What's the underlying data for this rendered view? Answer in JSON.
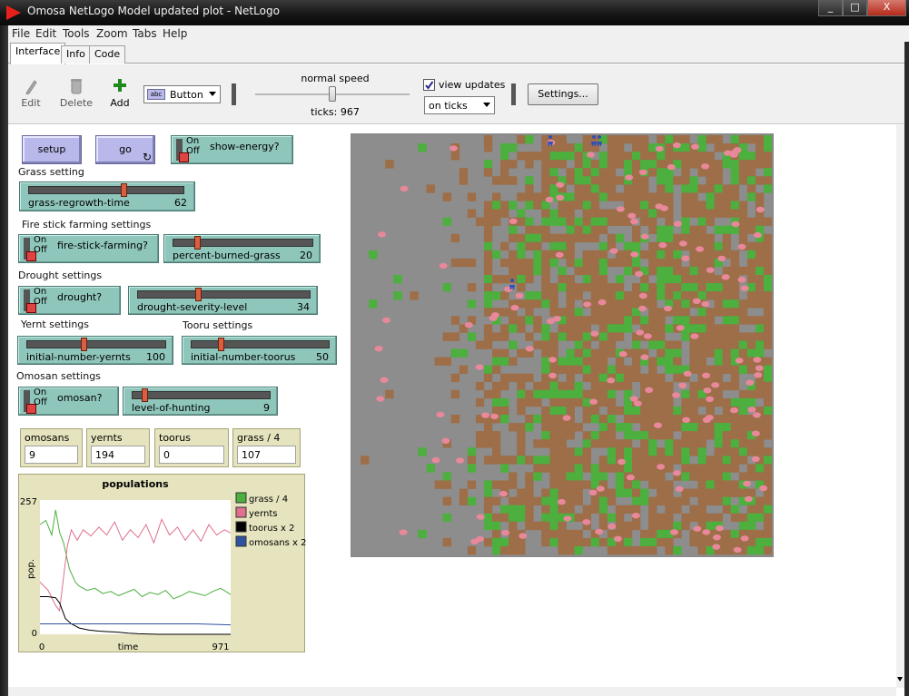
{
  "window": {
    "title": "Omosa NetLogo Model updated plot - NetLogo",
    "controls": [
      "_",
      "□",
      "X"
    ]
  },
  "menu": [
    "File",
    "Edit",
    "Tools",
    "Zoom",
    "Tabs",
    "Help"
  ],
  "tabs": [
    "Interface",
    "Info",
    "Code"
  ],
  "toolbar": {
    "edit": "Edit",
    "delete": "Delete",
    "add": "Add",
    "widget_type": "Button",
    "speed_label": "normal speed",
    "ticks": "ticks: 967",
    "view_updates": "view updates",
    "view_updates_checked": true,
    "update_mode": "on ticks",
    "settings": "Settings...",
    "speed_level": 0.5
  },
  "widgets": {
    "setup": "setup",
    "go": "go",
    "switch_on": "On",
    "switch_off": "Off",
    "show_energy": "show-energy?",
    "grass_note": "Grass setting",
    "grass_regrowth": {
      "name": "grass-regrowth-time",
      "value": "62",
      "fraction": 0.62
    },
    "fire_note": "Fire stick farming settings",
    "fire_switch": "fire-stick-farming?",
    "percent_burned": {
      "name": "percent-burned-grass",
      "value": "20",
      "fraction": 0.04
    },
    "drought_note": "Drought settings",
    "drought_switch": "drought?",
    "drought_severity": {
      "name": "drought-severity-level",
      "value": "34",
      "fraction": 0.34
    },
    "yernt_note": "Yernt settings",
    "tooru_note": "Tooru settings",
    "initial_yernts": {
      "name": "initial-number-yernts",
      "value": "100",
      "fraction": 0.4
    },
    "initial_toorus": {
      "name": "initial-number-toorus",
      "value": "50",
      "fraction": 0.2
    },
    "omosan_note": "Omosan settings",
    "omosan_switch": "omosan?",
    "hunting": {
      "name": "level-of-hunting",
      "value": "9",
      "fraction": 0.05
    }
  },
  "monitors": [
    {
      "label": "omosans",
      "value": "9"
    },
    {
      "label": "yernts",
      "value": "194"
    },
    {
      "label": "toorus",
      "value": "0"
    },
    {
      "label": "grass / 4",
      "value": "107"
    }
  ],
  "chart_data": {
    "type": "line",
    "title": "populations",
    "xlabel": "time",
    "ylabel": "pop.",
    "xlim": [
      0,
      971
    ],
    "ylim": [
      0,
      257
    ],
    "x_ticks": [
      "0",
      "971"
    ],
    "y_ticks": [
      "257",
      "0"
    ],
    "grid": false,
    "legend_position": "right",
    "series": [
      {
        "name": "grass / 4",
        "color": "#4caf3e",
        "x": [
          0,
          30,
          60,
          80,
          100,
          120,
          150,
          180,
          200,
          240,
          280,
          320,
          360,
          400,
          440,
          480,
          520,
          560,
          600,
          640,
          680,
          720,
          760,
          800,
          840,
          880,
          920,
          971
        ],
        "y": [
          210,
          218,
          190,
          238,
          195,
          175,
          125,
          100,
          92,
          84,
          88,
          78,
          82,
          74,
          80,
          86,
          72,
          80,
          76,
          84,
          68,
          74,
          82,
          78,
          74,
          82,
          88,
          76
        ]
      },
      {
        "name": "yernts",
        "color": "#e0708c",
        "x": [
          0,
          40,
          80,
          100,
          120,
          140,
          160,
          190,
          220,
          260,
          300,
          340,
          380,
          420,
          460,
          500,
          540,
          580,
          620,
          660,
          700,
          740,
          780,
          820,
          860,
          900,
          940,
          971
        ],
        "y": [
          100,
          85,
          55,
          45,
          110,
          170,
          200,
          180,
          200,
          188,
          205,
          190,
          215,
          180,
          200,
          185,
          210,
          175,
          220,
          190,
          205,
          180,
          200,
          178,
          210,
          190,
          200,
          194
        ]
      },
      {
        "name": "toorus x 2",
        "color": "#000000",
        "x": [
          0,
          40,
          80,
          100,
          130,
          160,
          200,
          250,
          300,
          350,
          400,
          450,
          500,
          600,
          700,
          800,
          971
        ],
        "y": [
          72,
          72,
          70,
          60,
          30,
          20,
          12,
          8,
          6,
          5,
          4,
          2,
          1,
          0,
          0,
          0,
          0
        ]
      },
      {
        "name": "omosans x 2",
        "color": "#3050a0",
        "x": [
          0,
          200,
          400,
          600,
          800,
          971
        ],
        "y": [
          20,
          20,
          20,
          20,
          20,
          18
        ]
      }
    ]
  },
  "world": {
    "colors": {
      "bare": "#8d8d8d",
      "dirt": "#9d6e48",
      "grass": "#4caf3e",
      "yernt": "#e8889a",
      "tooru": "#2f4fb8"
    }
  }
}
